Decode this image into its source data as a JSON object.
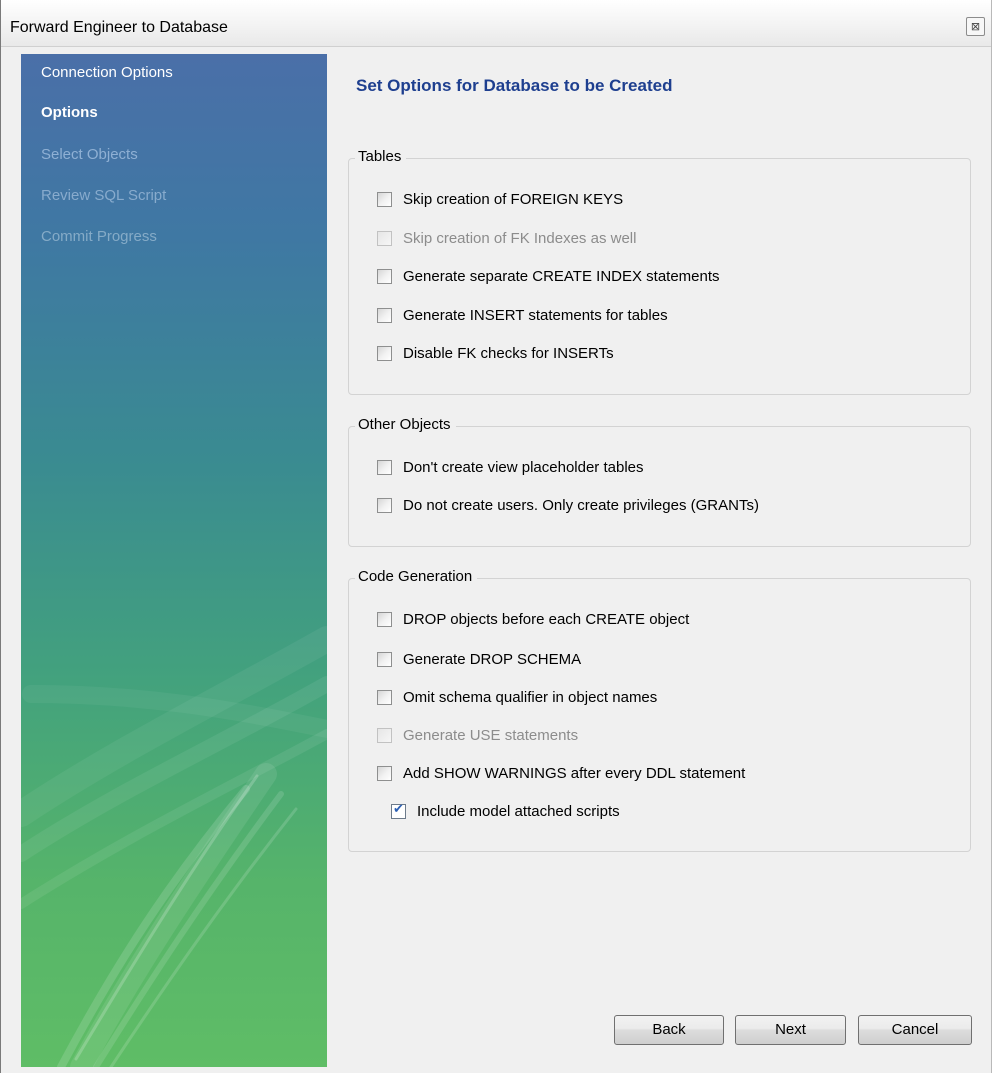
{
  "window": {
    "title": "Forward Engineer to Database",
    "close_symbol": "⊠"
  },
  "sidebar": {
    "steps": [
      {
        "label": "Connection Options",
        "state": "completed"
      },
      {
        "label": "Options",
        "state": "current"
      },
      {
        "label": "Select Objects",
        "state": "pending"
      },
      {
        "label": "Review SQL Script",
        "state": "pending"
      },
      {
        "label": "Commit Progress",
        "state": "pending"
      }
    ]
  },
  "main": {
    "heading": "Set Options for Database to be Created",
    "groups": {
      "tables": {
        "title": "Tables",
        "options": [
          {
            "label": "Skip creation of FOREIGN KEYS",
            "checked": false,
            "enabled": true
          },
          {
            "label": "Skip creation of FK Indexes as well",
            "checked": false,
            "enabled": false
          },
          {
            "label": "Generate separate CREATE INDEX statements",
            "checked": false,
            "enabled": true
          },
          {
            "label": "Generate INSERT statements for tables",
            "checked": false,
            "enabled": true
          },
          {
            "label": "Disable FK checks for INSERTs",
            "checked": false,
            "enabled": true
          }
        ]
      },
      "other_objects": {
        "title": "Other Objects",
        "options": [
          {
            "label": "Don't create view placeholder tables",
            "checked": false,
            "enabled": true
          },
          {
            "label": "Do not create users. Only create privileges (GRANTs)",
            "checked": false,
            "enabled": true
          }
        ]
      },
      "code_generation": {
        "title": "Code Generation",
        "options": [
          {
            "label": "DROP objects before each CREATE object",
            "checked": false,
            "enabled": true
          },
          {
            "label": "Generate DROP SCHEMA",
            "checked": false,
            "enabled": true
          },
          {
            "label": "Omit schema qualifier in object names",
            "checked": false,
            "enabled": true
          },
          {
            "label": "Generate USE statements",
            "checked": false,
            "enabled": false
          },
          {
            "label": "Add SHOW WARNINGS after every DDL statement",
            "checked": false,
            "enabled": true
          },
          {
            "label": "Include model attached scripts",
            "checked": true,
            "enabled": true
          }
        ]
      }
    }
  },
  "buttons": {
    "back": "Back",
    "next": "Next",
    "cancel": "Cancel"
  },
  "colors": {
    "heading": "#1e3f8f",
    "sidebar_top": "#4a6fa8",
    "sidebar_bottom": "#5fbd66",
    "disabled_text": "#8c8c8c"
  }
}
